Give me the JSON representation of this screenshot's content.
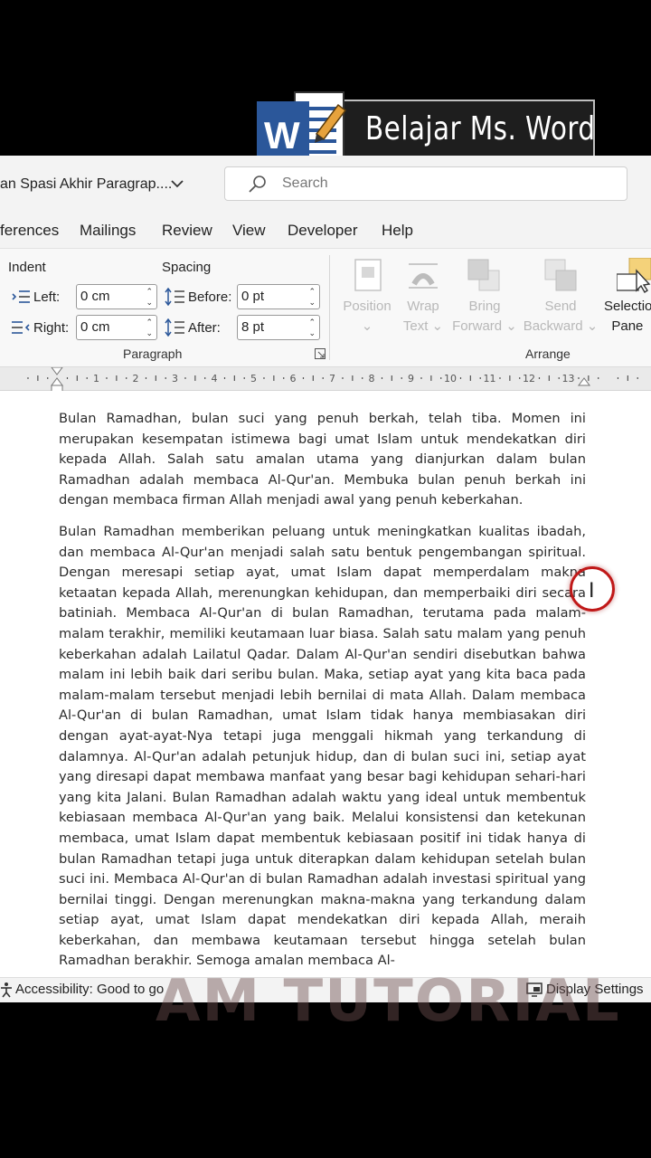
{
  "banner": {
    "title": "Belajar Ms. Word",
    "logo_letter": "W"
  },
  "titlebar": {
    "doc_title": "an Spasi Akhir Paragrap....",
    "search_placeholder": "Search"
  },
  "tabs": [
    "ferences",
    "Mailings",
    "Review",
    "View",
    "Developer",
    "Help"
  ],
  "ribbon": {
    "indent_label": "Indent",
    "spacing_label": "Spacing",
    "left_label": "Left:",
    "left_value": "0 cm",
    "right_label": "Right:",
    "right_value": "0 cm",
    "before_label": "Before:",
    "before_value": "0 pt",
    "after_label": "After:",
    "after_value": "8 pt",
    "paragraph_group": "Paragraph",
    "arrange_group": "Arrange",
    "arrange_buttons": [
      {
        "line1": "Position",
        "line2": ""
      },
      {
        "line1": "Wrap",
        "line2": "Text"
      },
      {
        "line1": "Bring",
        "line2": "Forward"
      },
      {
        "line1": "Send",
        "line2": "Backward"
      },
      {
        "line1": "Selectio",
        "line2": "Pane"
      }
    ]
  },
  "ruler": {
    "numbers": [
      "1",
      "2",
      "3",
      "4",
      "5",
      "6",
      "7",
      "8",
      "9",
      "10",
      "11",
      "12",
      "13"
    ]
  },
  "document": {
    "paragraphs": [
      "Bulan Ramadhan, bulan suci yang penuh berkah, telah tiba. Momen ini merupakan kesempatan istimewa bagi umat Islam untuk mendekatkan diri kepada Allah. Salah satu amalan utama yang dianjurkan dalam bulan Ramadhan adalah membaca Al-Qur'an. Membuka bulan penuh berkah ini dengan membaca firman Allah menjadi awal yang penuh keberkahan.",
      "Bulan Ramadhan memberikan peluang untuk meningkatkan kualitas ibadah, dan membaca Al-Qur'an menjadi salah satu bentuk pengembangan spiritual. Dengan meresapi setiap ayat, umat Islam dapat memperdalam makna ketaatan kepada Allah, merenungkan kehidupan, dan memperbaiki diri secara batiniah. Membaca Al-Qur'an di bulan Ramadhan, terutama pada malam-malam terakhir, memiliki keutamaan luar biasa. Salah satu malam yang penuh keberkahan adalah Lailatul Qadar. Dalam Al-Qur'an sendiri disebutkan bahwa malam ini lebih baik dari seribu bulan. Maka, setiap ayat yang kita baca pada malam-malam tersebut menjadi lebih bernilai di mata Allah. Dalam membaca Al-Qur'an di bulan Ramadhan, umat Islam tidak hanya membiasakan diri dengan ayat-ayat-Nya tetapi juga menggali hikmah yang terkandung di dalamnya. Al-Qur'an adalah petunjuk hidup, dan di bulan suci ini, setiap ayat yang diresapi dapat membawa manfaat yang besar bagi kehidupan sehari-hari yang kita Jalani. Bulan Ramadhan adalah waktu yang ideal untuk membentuk kebiasaan membaca Al-Qur'an yang baik. Melalui konsistensi dan ketekunan membaca, umat Islam dapat membentuk kebiasaan positif ini tidak hanya di bulan Ramadhan tetapi juga untuk diterapkan dalam kehidupan setelah bulan suci ini. Membaca Al-Qur'an di bulan Ramadhan adalah investasi spiritual yang bernilai tinggi. Dengan merenungkan makna-makna yang terkandung dalam setiap ayat, umat Islam dapat mendekatkan diri kepada Allah, meraih keberkahan, dan membawa keutamaan tersebut hingga setelah bulan Ramadhan berakhir. Semoga amalan membaca Al-"
    ]
  },
  "statusbar": {
    "accessibility": "Accessibility: Good to go",
    "display_settings": "Display Settings"
  },
  "watermark": "AM TUTORIAL",
  "colors": {
    "banner_bg": "#1e1e1e",
    "word_blue": "#2b579a",
    "cursor_circle": "#c01818"
  }
}
